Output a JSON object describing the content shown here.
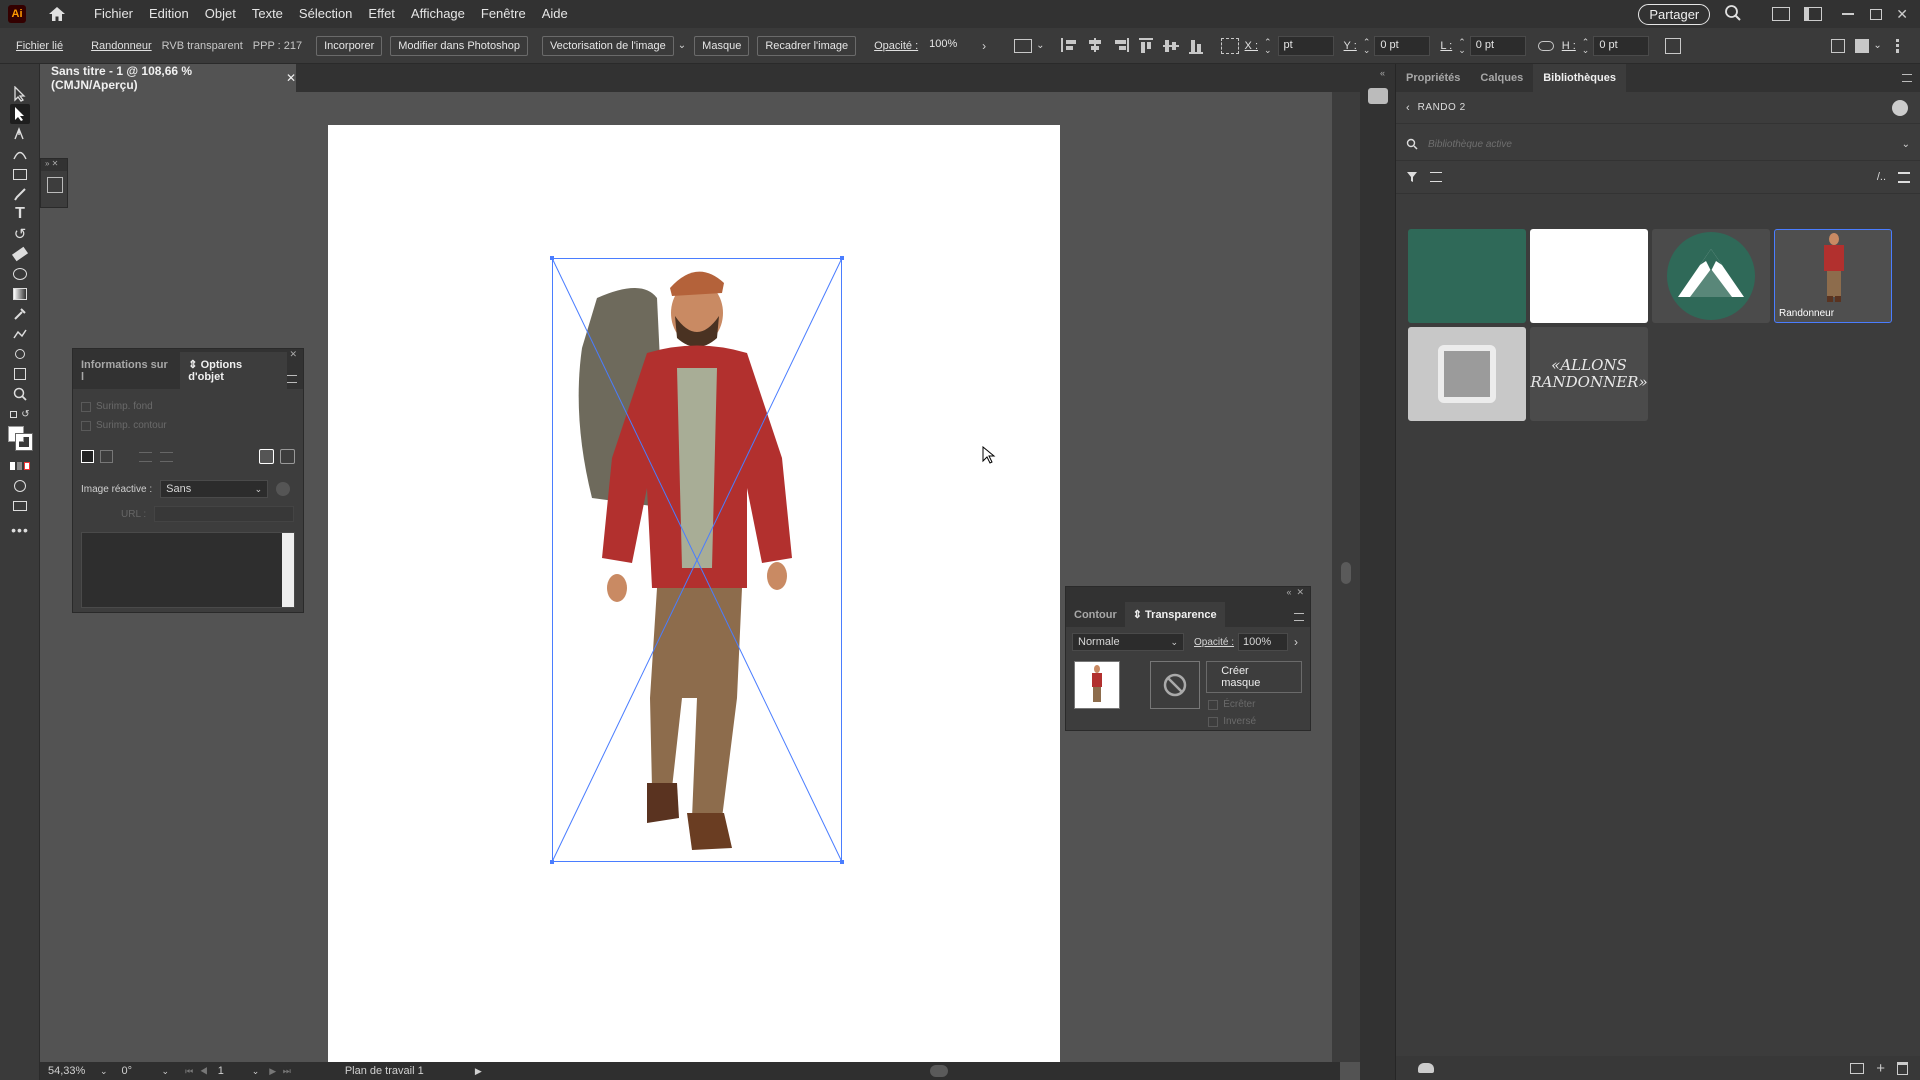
{
  "app": {
    "logo": "Ai"
  },
  "menu": [
    "Fichier",
    "Edition",
    "Objet",
    "Texte",
    "Sélection",
    "Effet",
    "Affichage",
    "Fenêtre",
    "Aide"
  ],
  "share_label": "Partager",
  "control": {
    "linked_file": "Fichier lié",
    "name": "Randonneur",
    "color_mode": "RVB transparent",
    "ppp": "PPP : 217",
    "embed": "Incorporer",
    "edit_photoshop": "Modifier dans Photoshop",
    "vectorize": "Vectorisation de l'image",
    "mask": "Masque",
    "crop": "Recadrer l'image",
    "opacity_label": "Opacité :",
    "opacity_value": "100%",
    "x_label": "X :",
    "x_value": "pt",
    "y_label": "Y :",
    "y_value": "0 pt",
    "w_label": "L :",
    "w_value": "0 pt",
    "h_label": "H :",
    "h_value": "0 pt"
  },
  "document": {
    "tab_title": "Sans titre - 1 @ 108,66 % (CMJN/Aperçu)"
  },
  "object_options_panel": {
    "tab1": "Informations sur l",
    "tab2": "Options d'objet",
    "overprint_fill": "Surimp. fond",
    "overprint_stroke": "Surimp. contour",
    "image_map_label": "Image réactive :",
    "image_map_value": "Sans",
    "url_label": "URL :"
  },
  "transparency_panel": {
    "tab1": "Contour",
    "tab2": "Transparence",
    "blend_mode": "Normale",
    "opacity_label": "Opacité :",
    "opacity_value": "100%",
    "make_mask": "Créer masque",
    "clip": "Écrêter",
    "invert": "Inversé"
  },
  "right_panel": {
    "tabs": [
      "Propriétés",
      "Calques",
      "Bibliothèques"
    ],
    "library_name": "RANDO 2",
    "search_placeholder": "Bibliothèque active",
    "selected_item_label": "Randonneur",
    "text_asset_line1": "«ALLONS",
    "text_asset_line2": "RANDONNER»"
  },
  "colors": {
    "swatch_green": "#2f6958",
    "selection_blue": "#4a7dff"
  },
  "status": {
    "zoom": "54,33%",
    "rotation": "0°",
    "page": "1",
    "artboard_name": "Plan de travail 1"
  }
}
